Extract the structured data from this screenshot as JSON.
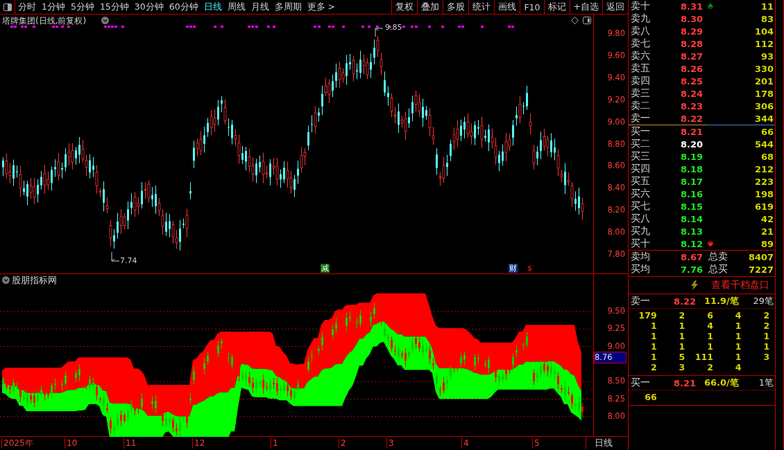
{
  "toolbar": {
    "periods": [
      {
        "label": "分时",
        "selected": false
      },
      {
        "label": "1分钟",
        "selected": false
      },
      {
        "label": "5分钟",
        "selected": false
      },
      {
        "label": "15分钟",
        "selected": false
      },
      {
        "label": "30分钟",
        "selected": false
      },
      {
        "label": "60分钟",
        "selected": false
      },
      {
        "label": "日线",
        "selected": true
      },
      {
        "label": "周线",
        "selected": false
      },
      {
        "label": "月线",
        "selected": false
      },
      {
        "label": "多周期",
        "selected": false
      }
    ],
    "more": "更多 >",
    "buttons": [
      "复权",
      "叠加",
      "多股",
      "统计",
      "画线",
      "F10",
      "标记",
      "+自选",
      "返回"
    ]
  },
  "chart": {
    "title": "塔牌集团(日线,前复权)",
    "high_label": "9.85",
    "low_label": "7.74",
    "y_ticks": [
      "9.80",
      "9.60",
      "9.40",
      "9.20",
      "9.00",
      "8.80",
      "8.60",
      "8.40",
      "8.20",
      "8.00",
      "7.80"
    ],
    "events": [
      {
        "label": "减",
        "kind": "reduce"
      },
      {
        "label": "财",
        "kind": "finance"
      },
      {
        "label": "$",
        "kind": "dividend"
      }
    ]
  },
  "indicator": {
    "title": "股朋指标网",
    "y_ticks": [
      "9.50",
      "9.25",
      "9.00",
      "8.50",
      "8.25",
      "8.00"
    ],
    "current": "8.76"
  },
  "date_axis": {
    "labels": [
      "2025年",
      "10",
      "11",
      "12",
      "1",
      "2",
      "3",
      "4",
      "5"
    ],
    "period": "日线"
  },
  "order_book": {
    "asks": [
      {
        "label": "卖十",
        "price": "8.31",
        "volume": "11",
        "color": "#ff3c3c",
        "arrow_up": true,
        "arrow_down": false
      },
      {
        "label": "卖九",
        "price": "8.30",
        "volume": "83",
        "color": "#ff3c3c",
        "arrow_up": false,
        "arrow_down": false
      },
      {
        "label": "卖八",
        "price": "8.29",
        "volume": "104",
        "color": "#ff3c3c",
        "arrow_up": false,
        "arrow_down": false
      },
      {
        "label": "卖七",
        "price": "8.28",
        "volume": "112",
        "color": "#ff3c3c",
        "arrow_up": false,
        "arrow_down": false
      },
      {
        "label": "卖六",
        "price": "8.27",
        "volume": "93",
        "color": "#ff3c3c",
        "arrow_up": false,
        "arrow_down": false
      },
      {
        "label": "卖五",
        "price": "8.26",
        "volume": "330",
        "color": "#ff3c3c",
        "arrow_up": false,
        "arrow_down": false
      },
      {
        "label": "卖四",
        "price": "8.25",
        "volume": "201",
        "color": "#ff3c3c",
        "arrow_up": false,
        "arrow_down": false
      },
      {
        "label": "卖三",
        "price": "8.24",
        "volume": "178",
        "color": "#ff3c3c",
        "arrow_up": false,
        "arrow_down": false
      },
      {
        "label": "卖二",
        "price": "8.23",
        "volume": "306",
        "color": "#ff3c3c",
        "arrow_up": false,
        "arrow_down": false
      },
      {
        "label": "卖一",
        "price": "8.22",
        "volume": "344",
        "color": "#ff3c3c",
        "arrow_up": false,
        "arrow_down": false
      }
    ],
    "bids": [
      {
        "label": "买一",
        "price": "8.21",
        "volume": "66",
        "color": "#ff3c3c",
        "arrow_up": false,
        "arrow_down": false
      },
      {
        "label": "买二",
        "price": "8.20",
        "volume": "544",
        "color": "#ffffff",
        "arrow_up": false,
        "arrow_down": false
      },
      {
        "label": "买三",
        "price": "8.19",
        "volume": "68",
        "color": "#1ee61e",
        "arrow_up": false,
        "arrow_down": false
      },
      {
        "label": "买四",
        "price": "8.18",
        "volume": "212",
        "color": "#1ee61e",
        "arrow_up": false,
        "arrow_down": false
      },
      {
        "label": "买五",
        "price": "8.17",
        "volume": "223",
        "color": "#1ee61e",
        "arrow_up": false,
        "arrow_down": false
      },
      {
        "label": "买六",
        "price": "8.16",
        "volume": "198",
        "color": "#1ee61e",
        "arrow_up": false,
        "arrow_down": false
      },
      {
        "label": "买七",
        "price": "8.15",
        "volume": "619",
        "color": "#1ee61e",
        "arrow_up": false,
        "arrow_down": false
      },
      {
        "label": "买八",
        "price": "8.14",
        "volume": "42",
        "color": "#1ee61e",
        "arrow_up": false,
        "arrow_down": false
      },
      {
        "label": "买九",
        "price": "8.13",
        "volume": "21",
        "color": "#1ee61e",
        "arrow_up": false,
        "arrow_down": false
      },
      {
        "label": "买十",
        "price": "8.12",
        "volume": "89",
        "color": "#1ee61e",
        "arrow_up": false,
        "arrow_down": true
      }
    ],
    "averages": [
      {
        "label": "卖均",
        "price": "8.67",
        "color": "#ff3c3c",
        "total_label": "总卖",
        "total": "8407"
      },
      {
        "label": "买均",
        "price": "7.76",
        "color": "#1ee61e",
        "total_label": "总买",
        "total": "7227"
      }
    ]
  },
  "depth_link": "查看千档盘口",
  "queues": [
    {
      "label": "卖一",
      "price": "8.22",
      "average": "11.9/笔",
      "count": "29笔",
      "orders": [
        [
          "179",
          "2",
          "6",
          "4",
          "2"
        ],
        [
          "1",
          "1",
          "4",
          "1",
          "2"
        ],
        [
          "1",
          "1",
          "1",
          "1",
          "1"
        ],
        [
          "1",
          "1",
          "1",
          "1",
          "1"
        ],
        [
          "1",
          "5",
          "111",
          "1",
          "3"
        ],
        [
          "2",
          "3",
          "2",
          "4"
        ]
      ]
    },
    {
      "label": "买一",
      "price": "8.21",
      "average": "66.0/笔",
      "count": "1笔",
      "orders": [
        [
          "66"
        ]
      ]
    }
  ]
}
